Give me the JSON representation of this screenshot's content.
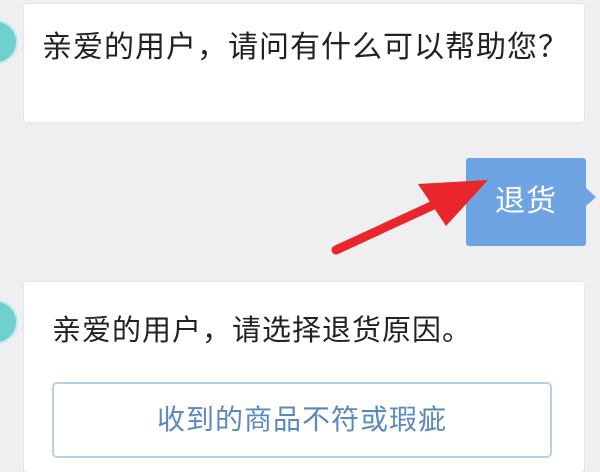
{
  "messages": {
    "service_greeting": "亲爱的用户，请问有什么可以帮助您？",
    "user_reply": "退货",
    "service_prompt": "亲爱的用户，请选择退货原因。",
    "options": [
      {
        "label": "收到的商品不符或瑕疵"
      }
    ]
  },
  "colors": {
    "background": "#efeff1",
    "user_bubble": "#6fa4e4",
    "option_text": "#5b88bf",
    "annotation_arrow": "#e8262b"
  },
  "icons": {
    "annotation": "red-arrow-icon"
  }
}
